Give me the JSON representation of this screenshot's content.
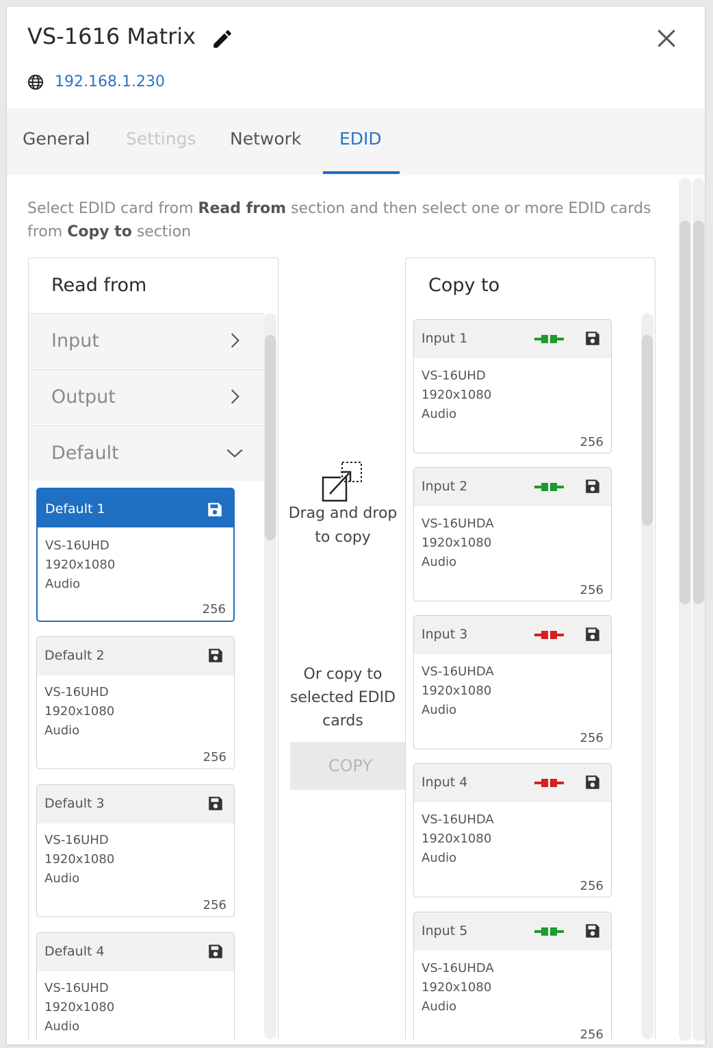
{
  "header": {
    "title": "VS-1616 Matrix",
    "ip": "192.168.1.230"
  },
  "tabs": [
    {
      "label": "General",
      "state": "normal"
    },
    {
      "label": "Settings",
      "state": "disabled"
    },
    {
      "label": "Network",
      "state": "normal"
    },
    {
      "label": "EDID",
      "state": "active"
    }
  ],
  "instructions": {
    "part1": "Select EDID card from ",
    "bold1": "Read from",
    "part2": " section and then select one or more EDID cards from ",
    "bold2": "Copy to",
    "part3": " section"
  },
  "read_from": {
    "title": "Read from",
    "categories": [
      {
        "label": "Input",
        "chevron": "chevron-right-icon"
      },
      {
        "label": "Output",
        "chevron": "chevron-right-icon"
      },
      {
        "label": "Default",
        "chevron": "chevron-down-icon"
      }
    ],
    "cards": [
      {
        "name": "Default 1",
        "model": "VS-16UHD",
        "resolution": "1920x1080",
        "audio": "Audio",
        "size": "256",
        "selected": true
      },
      {
        "name": "Default 2",
        "model": "VS-16UHD",
        "resolution": "1920x1080",
        "audio": "Audio",
        "size": "256",
        "selected": false
      },
      {
        "name": "Default 3",
        "model": "VS-16UHD",
        "resolution": "1920x1080",
        "audio": "Audio",
        "size": "256",
        "selected": false
      },
      {
        "name": "Default 4",
        "model": "VS-16UHD",
        "resolution": "1920x1080",
        "audio": "Audio",
        "size": "256",
        "selected": false
      }
    ]
  },
  "middle": {
    "drag_line1": "Drag and drop",
    "drag_line2": "to copy",
    "or_line1": "Or copy to",
    "or_line2": "selected EDID",
    "or_line3": "cards",
    "copy_label": "COPY"
  },
  "copy_to": {
    "title": "Copy to",
    "cards": [
      {
        "name": "Input 1",
        "model": "VS-16UHD",
        "resolution": "1920x1080",
        "audio": "Audio",
        "size": "256",
        "connection": "connected"
      },
      {
        "name": "Input 2",
        "model": "VS-16UHDA",
        "resolution": "1920x1080",
        "audio": "Audio",
        "size": "256",
        "connection": "connected"
      },
      {
        "name": "Input 3",
        "model": "VS-16UHDA",
        "resolution": "1920x1080",
        "audio": "Audio",
        "size": "256",
        "connection": "disconnected"
      },
      {
        "name": "Input 4",
        "model": "VS-16UHDA",
        "resolution": "1920x1080",
        "audio": "Audio",
        "size": "256",
        "connection": "disconnected"
      },
      {
        "name": "Input 5",
        "model": "VS-16UHDA",
        "resolution": "1920x1080",
        "audio": "Audio",
        "size": "256",
        "connection": "connected"
      }
    ]
  },
  "colors": {
    "accent": "#1f6fc2",
    "link": "#2a74c8",
    "connected": "#1e9a2e",
    "disconnected": "#d81f1f"
  }
}
